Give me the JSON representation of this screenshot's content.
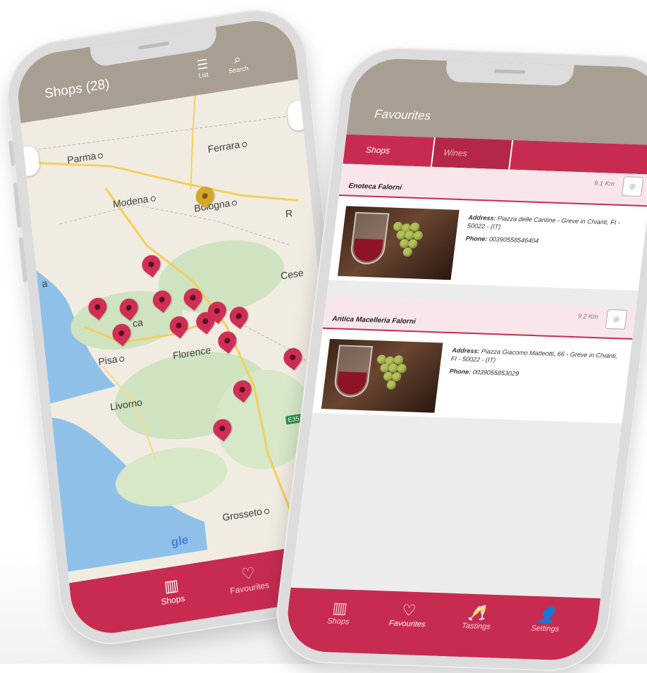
{
  "shops_screen": {
    "title": "Shops (28)",
    "actions": [
      {
        "label": "List",
        "icon": "list-icon"
      },
      {
        "label": "Search",
        "icon": "search-icon"
      }
    ],
    "map": {
      "cities": [
        "Parma",
        "Ferrara",
        "Modena",
        "Bologna",
        "Pisa",
        "Florence",
        "Livorno",
        "Grosseto",
        "Cese",
        "R",
        "a",
        "ca"
      ],
      "road_badge": "E35",
      "attribution": "gle"
    },
    "nav": [
      {
        "label": "Shops",
        "icon": "map-icon",
        "active": true
      },
      {
        "label": "Favourites",
        "icon": "heart-icon",
        "active": false
      }
    ]
  },
  "favourites_screen": {
    "title": "Favourites",
    "tabs": [
      {
        "label": "Shops",
        "active": true
      },
      {
        "label": "Wines",
        "active": false
      }
    ],
    "items": [
      {
        "name": "Enoteca Falorni",
        "distance": "9.1 Km",
        "address_label": "Address:",
        "address": "Piazza delle Cantine - Greve in Chianti, FI - 50022 - (IT)",
        "phone_label": "Phone:",
        "phone": "00390558546404"
      },
      {
        "name": "Antica Macelleria Falorni",
        "distance": "9.2 Km",
        "address_label": "Address:",
        "address": "Piazza Giacomo Matteotti, 66 - Greve in Chianti, FI - 50022 - (IT)",
        "phone_label": "Phone:",
        "phone": "0039055853029"
      }
    ],
    "nav": [
      {
        "label": "Shops",
        "icon": "map-icon",
        "active": false
      },
      {
        "label": "Favourites",
        "icon": "heart-icon",
        "active": true
      },
      {
        "label": "Tastings",
        "icon": "wine-glasses-icon",
        "active": false
      },
      {
        "label": "Settings",
        "icon": "person-icon",
        "active": false
      }
    ]
  },
  "colors": {
    "header": "#a89e92",
    "accent": "#c72c50",
    "pin_red": "#cf2e55",
    "pin_gold": "#d3a82a"
  }
}
